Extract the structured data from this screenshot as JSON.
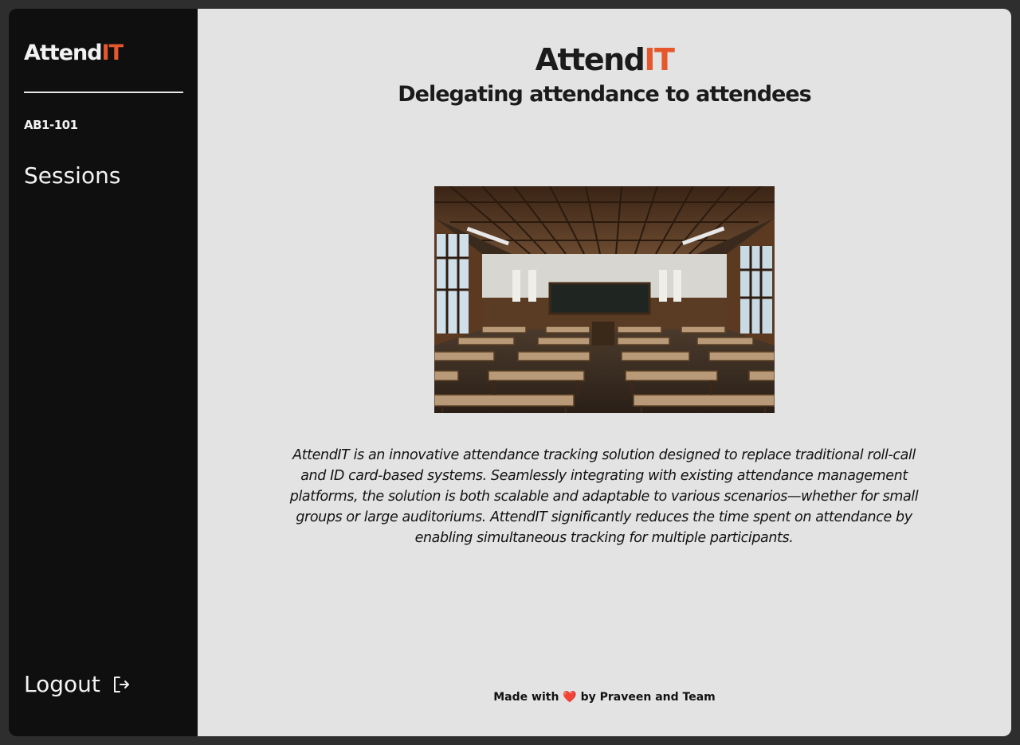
{
  "sidebar": {
    "logo_main": "Attend",
    "logo_accent": "IT",
    "room_code": "AB1-101",
    "nav_sessions": "Sessions",
    "logout_label": "Logout",
    "logout_icon": "logout-icon"
  },
  "main": {
    "title_main": "Attend",
    "title_accent": "IT",
    "subtitle": "Delegating attendance to attendees",
    "image_subject": "classroom-photo",
    "description": "AttendIT is an innovative attendance tracking solution designed to replace traditional roll-call and ID card-based systems. Seamlessly integrating with existing attendance management platforms, the solution is both scalable and adaptable to various scenarios—whether for small groups or large auditoriums. AttendIT significantly reduces the time spent on attendance by enabling simultaneous tracking for multiple participants.",
    "footer_prefix": "Made with",
    "footer_heart": "❤️",
    "footer_suffix": "by Praveen and Team"
  },
  "colors": {
    "accent": "#e6582b",
    "sidebar_bg": "#0f0f0f",
    "main_bg": "#e3e3e3"
  }
}
